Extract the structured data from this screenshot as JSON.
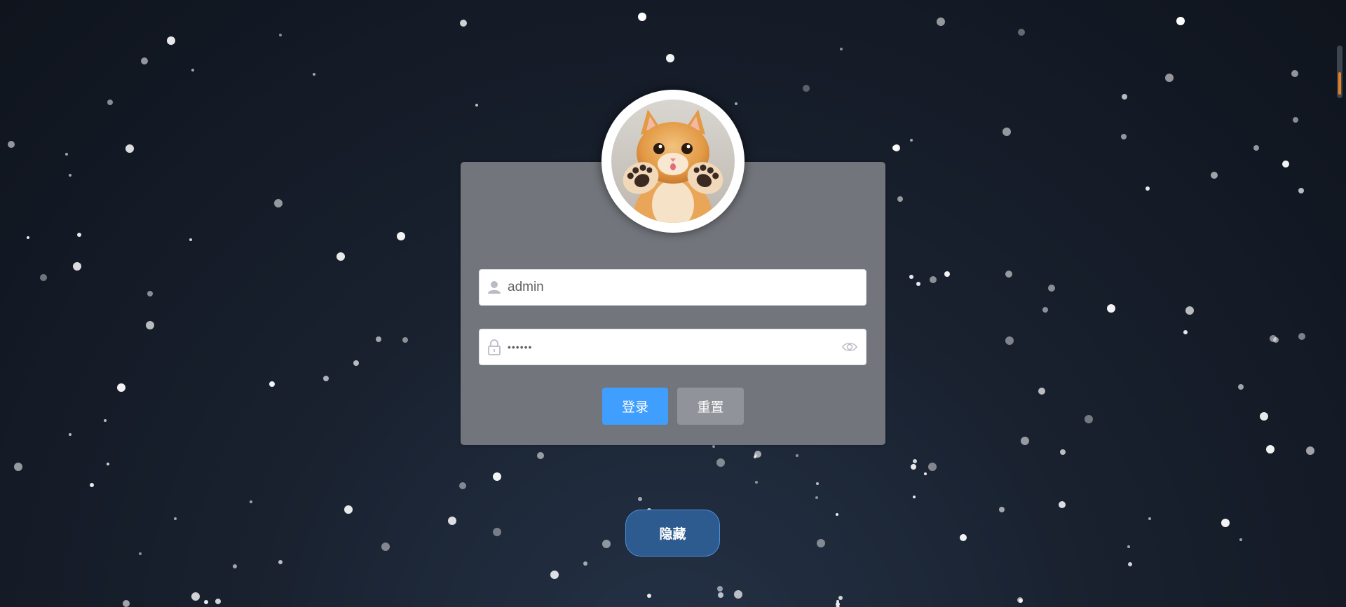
{
  "login": {
    "username_value": "admin",
    "password_value": "••••••",
    "login_label": "登录",
    "reset_label": "重置"
  },
  "hide_label": "隐藏",
  "icons": {
    "username_prefix": "user-icon",
    "password_prefix": "lock-icon",
    "password_suffix": "eye-icon",
    "avatar": "cat-avatar-image"
  },
  "colors": {
    "primary": "#409eff",
    "secondary": "#909399",
    "card": "#72767c",
    "hide_button": "#2e5b8f",
    "scroll_accent": "#e67e22"
  }
}
